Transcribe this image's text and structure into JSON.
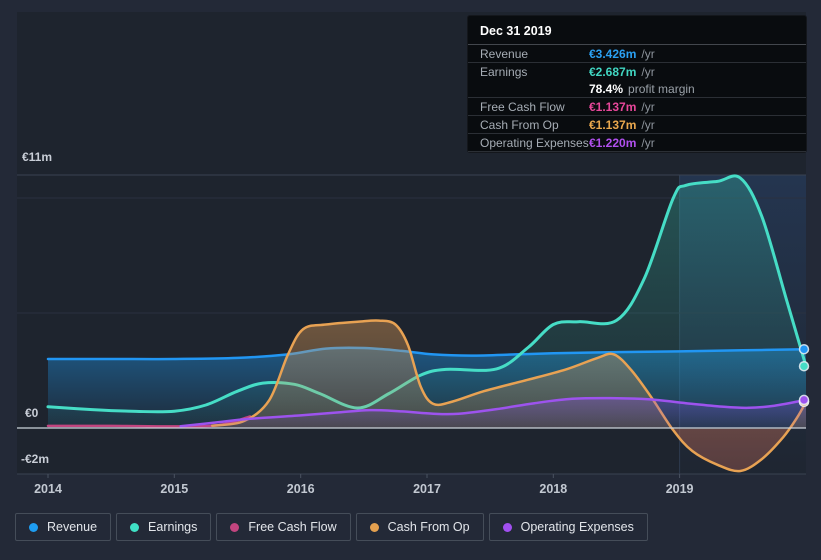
{
  "tooltip": {
    "date": "Dec 31 2019",
    "rows": [
      {
        "label": "Revenue",
        "value": "€3.426m",
        "suffix": "/yr",
        "color": "#2ba0f2"
      },
      {
        "label": "Earnings",
        "value": "€2.687m",
        "suffix": "/yr",
        "color": "#41d6c2",
        "sub_bold": "78.4%",
        "sub_text": "profit margin"
      },
      {
        "label": "Free Cash Flow",
        "value": "€1.137m",
        "suffix": "/yr",
        "color": "#e8479a"
      },
      {
        "label": "Cash From Op",
        "value": "€1.137m",
        "suffix": "/yr",
        "color": "#eaa84e"
      },
      {
        "label": "Operating Expenses",
        "value": "€1.220m",
        "suffix": "/yr",
        "color": "#b150ee"
      }
    ]
  },
  "axis": {
    "y_top_label": "€11m",
    "y_zero_label": "€0",
    "y_bottom_label": "-€2m"
  },
  "legend": [
    {
      "label": "Revenue",
      "color": "#1e9df2"
    },
    {
      "label": "Earnings",
      "color": "#3fe0c5"
    },
    {
      "label": "Free Cash Flow",
      "color": "#c2457f"
    },
    {
      "label": "Cash From Op",
      "color": "#e4a04f"
    },
    {
      "label": "Operating Expenses",
      "color": "#a14ff0"
    }
  ],
  "chart_data": {
    "type": "area",
    "x_unit": "year",
    "y_unit": "€m",
    "ylim": [
      -2,
      11
    ],
    "gridline_values": [
      0,
      5,
      10,
      11
    ],
    "x_ticks": [
      "2014",
      "2015",
      "2016",
      "2017",
      "2018",
      "2019"
    ],
    "highlight_band_start": 2019,
    "colors": {
      "revenue": "#2196f3",
      "earnings": "#46ddc6",
      "fcf": "#c2457f",
      "cashop": "#e8a253",
      "opex": "#9d53ee",
      "zero_line": "#ccd3db",
      "grid": "#2a3140",
      "grid_top": "#3a4251",
      "page_bg": "#232937",
      "plot_bg": "#1e242e"
    },
    "series": [
      {
        "name": "Revenue",
        "color": "#2196f3",
        "points": [
          [
            2014,
            3.0
          ],
          [
            2014.5,
            3.0
          ],
          [
            2015,
            3.0
          ],
          [
            2015.5,
            3.05
          ],
          [
            2015.9,
            3.2
          ],
          [
            2016.2,
            3.45
          ],
          [
            2016.5,
            3.48
          ],
          [
            2016.8,
            3.35
          ],
          [
            2017.05,
            3.2
          ],
          [
            2017.35,
            3.15
          ],
          [
            2017.7,
            3.2
          ],
          [
            2018,
            3.25
          ],
          [
            2018.5,
            3.3
          ],
          [
            2019,
            3.33
          ],
          [
            2019.5,
            3.38
          ],
          [
            2020,
            3.426
          ]
        ]
      },
      {
        "name": "Earnings",
        "color": "#46ddc6",
        "points": [
          [
            2014,
            0.92
          ],
          [
            2014.35,
            0.8
          ],
          [
            2014.7,
            0.72
          ],
          [
            2015,
            0.73
          ],
          [
            2015.25,
            1.0
          ],
          [
            2015.5,
            1.6
          ],
          [
            2015.7,
            1.95
          ],
          [
            2015.95,
            1.9
          ],
          [
            2016.15,
            1.5
          ],
          [
            2016.45,
            0.87
          ],
          [
            2016.7,
            1.5
          ],
          [
            2016.95,
            2.3
          ],
          [
            2017.15,
            2.55
          ],
          [
            2017.55,
            2.57
          ],
          [
            2017.8,
            3.5
          ],
          [
            2018.0,
            4.5
          ],
          [
            2018.2,
            4.62
          ],
          [
            2018.5,
            4.68
          ],
          [
            2018.72,
            6.5
          ],
          [
            2018.95,
            10.0
          ],
          [
            2019.05,
            10.55
          ],
          [
            2019.3,
            10.72
          ],
          [
            2019.48,
            10.87
          ],
          [
            2019.65,
            9.2
          ],
          [
            2019.85,
            5.5
          ],
          [
            2020,
            2.687
          ]
        ]
      },
      {
        "name": "Free Cash Flow",
        "color": "#c2457f",
        "points": [
          [
            2014,
            0.09
          ],
          [
            2014.5,
            0.09
          ],
          [
            2015,
            0.07
          ],
          [
            2015.35,
            0.12
          ],
          [
            2015.6,
            0.5
          ]
        ]
      },
      {
        "name": "Cash From Op",
        "color": "#e8a253",
        "points": [
          [
            2015.3,
            0.1
          ],
          [
            2015.55,
            0.3
          ],
          [
            2015.75,
            1.2
          ],
          [
            2015.9,
            3.2
          ],
          [
            2016.02,
            4.3
          ],
          [
            2016.2,
            4.5
          ],
          [
            2016.45,
            4.62
          ],
          [
            2016.62,
            4.67
          ],
          [
            2016.75,
            4.5
          ],
          [
            2016.85,
            3.6
          ],
          [
            2016.95,
            1.8
          ],
          [
            2017.05,
            1.05
          ],
          [
            2017.2,
            1.15
          ],
          [
            2017.45,
            1.6
          ],
          [
            2017.8,
            2.1
          ],
          [
            2018.1,
            2.55
          ],
          [
            2018.35,
            3.05
          ],
          [
            2018.48,
            3.2
          ],
          [
            2018.62,
            2.5
          ],
          [
            2018.78,
            1.3
          ],
          [
            2018.95,
            -0.1
          ],
          [
            2019.1,
            -1.0
          ],
          [
            2019.3,
            -1.6
          ],
          [
            2019.48,
            -1.87
          ],
          [
            2019.65,
            -1.35
          ],
          [
            2019.82,
            -0.4
          ],
          [
            2019.93,
            0.45
          ],
          [
            2020,
            1.137
          ]
        ]
      },
      {
        "name": "Operating Expenses",
        "color": "#9d53ee",
        "points": [
          [
            2015.05,
            0.08
          ],
          [
            2015.3,
            0.22
          ],
          [
            2015.6,
            0.4
          ],
          [
            2016,
            0.55
          ],
          [
            2016.3,
            0.68
          ],
          [
            2016.55,
            0.78
          ],
          [
            2016.8,
            0.72
          ],
          [
            2017.05,
            0.62
          ],
          [
            2017.25,
            0.62
          ],
          [
            2017.55,
            0.82
          ],
          [
            2017.85,
            1.08
          ],
          [
            2018.15,
            1.27
          ],
          [
            2018.45,
            1.3
          ],
          [
            2018.75,
            1.25
          ],
          [
            2019.05,
            1.08
          ],
          [
            2019.35,
            0.92
          ],
          [
            2019.55,
            0.88
          ],
          [
            2019.75,
            0.97
          ],
          [
            2020,
            1.22
          ]
        ]
      }
    ],
    "end_dots": [
      {
        "series": "Free Cash Flow",
        "value": 1.137,
        "color": "#c2457f"
      },
      {
        "series": "Cash From Op",
        "value": 1.137,
        "color": "#e8a253"
      },
      {
        "series": "Operating Expenses",
        "value": 1.22,
        "color": "#9d53ee"
      },
      {
        "series": "Revenue",
        "value": 3.426,
        "color": "#2196f3"
      },
      {
        "series": "Earnings",
        "value": 2.687,
        "color": "#46ddc6"
      }
    ]
  }
}
